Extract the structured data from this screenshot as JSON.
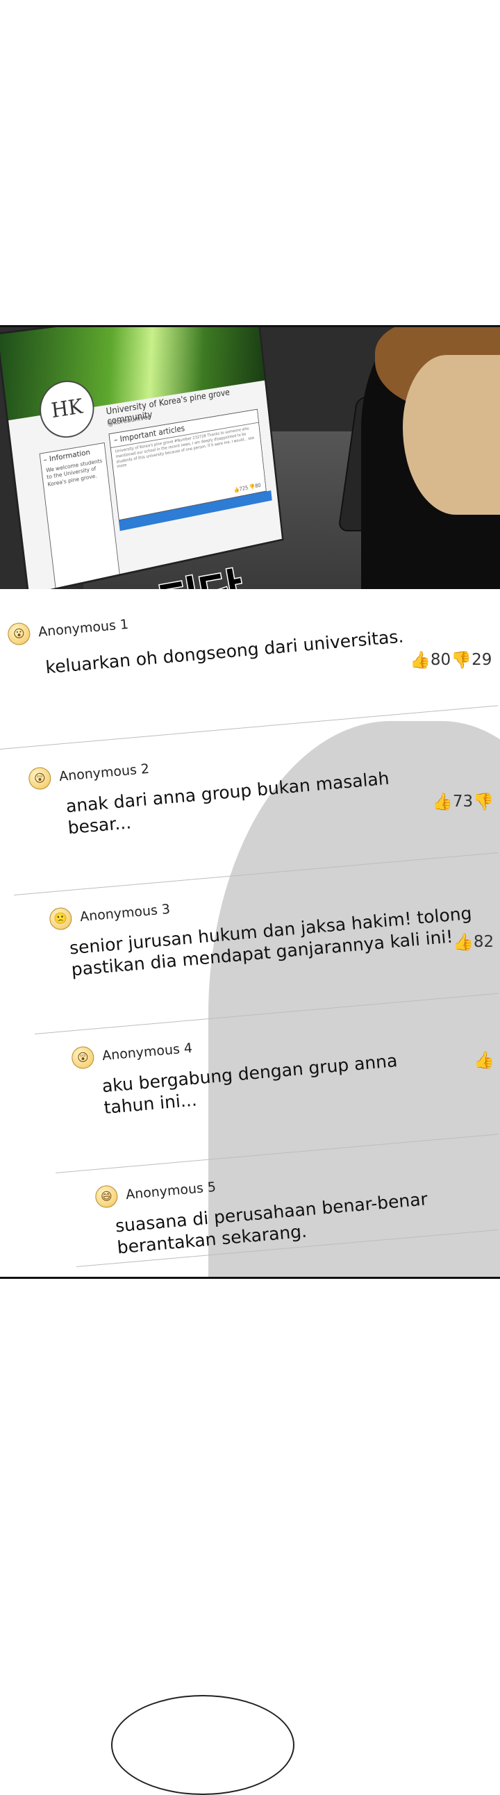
{
  "screen": {
    "logo": "HK",
    "community_title": "University of Korea's pine grove community",
    "handle": "@koreauniver",
    "important_title": "Important articles",
    "important_text": "University of Korea's pine grove #Number 232728 Thanks to someone who mentioned our school in the recent news, I am deeply disappointed to be students of this university because of one person. If it were me, I would... see more",
    "likes": "725",
    "dislikes": "80",
    "info_title": "Information",
    "info_text": "We welcome students to the University of Korea's pine grove."
  },
  "sfx": "타닥",
  "comments": [
    {
      "author": "Anonymous 1",
      "emoji": "😮",
      "text": "keluarkan oh dongseong dari universitas.",
      "likes": "80",
      "dislikes": "29"
    },
    {
      "author": "Anonymous 2",
      "emoji": "😲",
      "text": "anak dari anna group bukan masalah besar...",
      "likes": "73",
      "dislikes": ""
    },
    {
      "author": "Anonymous 3",
      "emoji": "🙁",
      "text": "senior jurusan hukum dan jaksa hakim! tolong pastikan dia mendapat ganjarannya kali ini!",
      "likes": "82",
      "dislikes": ""
    },
    {
      "author": "Anonymous 4",
      "emoji": "😲",
      "text": "aku bergabung dengan grup anna tahun ini...",
      "likes": "",
      "dislikes": ""
    },
    {
      "author": "Anonymous 5",
      "emoji": "😄",
      "text": "suasana di perusahaan benar-benar berantakan sekarang.",
      "likes": "",
      "dislikes": ""
    }
  ],
  "icons": {
    "like": "thumbs-up-icon",
    "dislike": "thumbs-down-icon"
  }
}
